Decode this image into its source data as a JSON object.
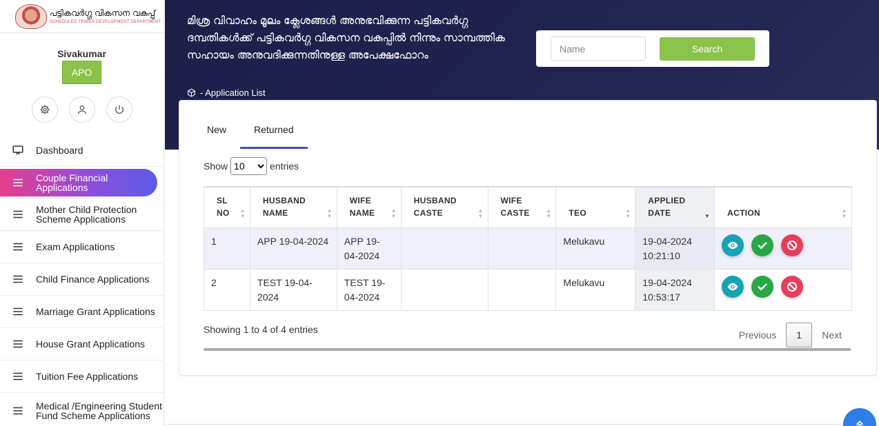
{
  "logo": {
    "main_text": "പട്ടികവർഗ്ഗ വികസന വകുപ്പ്",
    "sub_text": "SCHEDULED TRIBES DEVELOPMENT DEPARTMENT"
  },
  "user": {
    "name": "Sivakumar",
    "role": "APO"
  },
  "sidebar": {
    "items": [
      {
        "label": "Dashboard",
        "icon": "monitor-icon"
      },
      {
        "label": "Couple Financial Applications",
        "icon": "menu-icon",
        "active": true
      },
      {
        "label": "Mother Child Protection Scheme Applications",
        "icon": "menu-icon"
      },
      {
        "label": "Exam Applications",
        "icon": "menu-icon"
      },
      {
        "label": "Child Finance Applications",
        "icon": "menu-icon"
      },
      {
        "label": "Marriage Grant Applications",
        "icon": "menu-icon"
      },
      {
        "label": "House Grant Applications",
        "icon": "menu-icon"
      },
      {
        "label": "Tuition Fee Applications",
        "icon": "menu-icon"
      },
      {
        "label": "Medical /Engineering Student Fund Scheme Applications",
        "icon": "menu-icon"
      }
    ]
  },
  "header": {
    "title": "മിശ്ര വിവാഹം മൂലം ക്ലേശങ്ങൾ അനുഭവിക്കുന്ന പട്ടികവർഗ്ഗ ദമ്പതികൾക്ക് പട്ടികവർഗ്ഗ വികസന വകുപ്പിൽ നിന്നും സാമ്പത്തിക സഹായം അനുവദിക്കുന്നതിനുള്ള അപേക്ഷഫോറം",
    "breadcrumb": "- Application List"
  },
  "search": {
    "placeholder": "Name",
    "value": "",
    "button_label": "Search"
  },
  "tabs": [
    {
      "label": "New",
      "active": false
    },
    {
      "label": "Returned",
      "active": true
    }
  ],
  "entries": {
    "show_label": "Show",
    "selected": "10",
    "entries_label": "entries"
  },
  "table": {
    "columns": [
      "SL NO",
      "HUSBAND NAME",
      "WIFE NAME",
      "HUSBAND CASTE",
      "WIFE CASTE",
      "TEO",
      "APPLIED DATE",
      "ACTION"
    ],
    "rows": [
      {
        "sl": "1",
        "husband": "APP 19-04-2024",
        "wife": "APP 19-04-2024",
        "husband_caste": "",
        "wife_caste": "",
        "teo": "Melukavu",
        "date": "19-04-2024 10:21:10"
      },
      {
        "sl": "2",
        "husband": "TEST 19-04-2024",
        "wife": "TEST 19-04-2024",
        "husband_caste": "",
        "wife_caste": "",
        "teo": "Melukavu",
        "date": "19-04-2024 10:53:17"
      }
    ]
  },
  "footer": {
    "info": "Showing 1 to 4 of 4 entries",
    "previous": "Previous",
    "page": "1",
    "next": "Next"
  },
  "colors": {
    "accent_green": "#8bc34a",
    "header_navy": "#1d1f4a",
    "view": "#17a2b8",
    "approve": "#28a745",
    "reject": "#e83e5c",
    "fab": "#2f7ee6"
  }
}
